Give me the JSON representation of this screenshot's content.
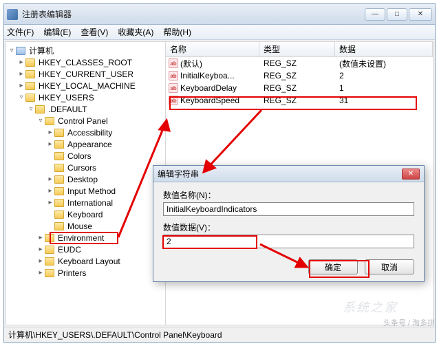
{
  "window": {
    "title": "注册表编辑器",
    "min": "—",
    "max": "□",
    "close": "✕"
  },
  "menu": {
    "file": "文件(F)",
    "edit": "编辑(E)",
    "view": "查看(V)",
    "favorites": "收藏夹(A)",
    "help": "帮助(H)"
  },
  "tree": {
    "root": "计算机",
    "hkcr": "HKEY_CLASSES_ROOT",
    "hkcu": "HKEY_CURRENT_USER",
    "hklm": "HKEY_LOCAL_MACHINE",
    "hku": "HKEY_USERS",
    "default": ".DEFAULT",
    "cpl": "Control Panel",
    "items": [
      "Accessibility",
      "Appearance",
      "Colors",
      "Cursors",
      "Desktop",
      "Input Method",
      "International",
      "Keyboard",
      "Mouse"
    ],
    "env": "Environment",
    "eudc": "EUDC",
    "kblayout": "Keyboard Layout",
    "printers": "Printers"
  },
  "list": {
    "cols": {
      "name": "名称",
      "type": "类型",
      "data": "数据"
    },
    "rows": [
      {
        "name": "(默认)",
        "type": "REG_SZ",
        "data": "(数值未设置)"
      },
      {
        "name": "InitialKeyboa...",
        "type": "REG_SZ",
        "data": "2"
      },
      {
        "name": "KeyboardDelay",
        "type": "REG_SZ",
        "data": "1"
      },
      {
        "name": "KeyboardSpeed",
        "type": "REG_SZ",
        "data": "31"
      }
    ],
    "ab": "ab"
  },
  "dialog": {
    "title": "编辑字符串",
    "name_label": "数值名称(N)：",
    "name_value": "InitialKeyboardIndicators",
    "data_label": "数值数据(V)：",
    "data_value": "2",
    "ok": "确定",
    "cancel": "取消"
  },
  "status": {
    "path": "计算机\\HKEY_USERS\\.DEFAULT\\Control Panel\\Keyboard"
  },
  "watermark": {
    "line1": "系统之家",
    "line2": "头条号 / 淘多拼"
  }
}
